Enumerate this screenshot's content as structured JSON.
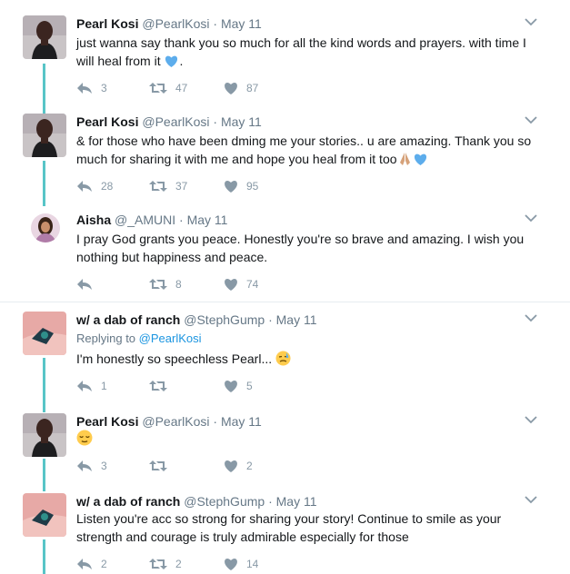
{
  "tweets": [
    {
      "name": "Pearl Kosi",
      "handle": "@PearlKosi",
      "date": "May 11",
      "text": "just wanna say thank you so much for all the kind words and prayers. with time I will heal from it",
      "emoji": "blue-heart",
      "text_suffix": ".",
      "replies": "3",
      "retweets": "47",
      "likes": "87"
    },
    {
      "name": "Pearl Kosi",
      "handle": "@PearlKosi",
      "date": "May 11",
      "text": "& for those who have been dming me your stories.. u are amazing. Thank you so much for sharing it with me and hope you heal from it too",
      "emoji": "praying-hands-and-blue-heart",
      "replies": "28",
      "retweets": "37",
      "likes": "95"
    },
    {
      "name": "Aisha",
      "handle": "@_AMUNI",
      "date": "May 11",
      "text": "I pray God grants you peace. Honestly you're so brave and amazing. I wish you nothing but happiness and peace.",
      "replies": "",
      "retweets": "8",
      "likes": "74"
    },
    {
      "name": "w/ a dab of ranch",
      "handle": "@StephGump",
      "date": "May 11",
      "replying_label": "Replying to",
      "replying_to": "@PearlKosi",
      "text": "I'm honestly so speechless Pearl...",
      "emoji": "sad-relieved-face",
      "replies": "1",
      "retweets": "",
      "likes": "5"
    },
    {
      "name": "Pearl Kosi",
      "handle": "@PearlKosi",
      "date": "May 11",
      "text": "",
      "emoji": "relieved-face",
      "replies": "3",
      "retweets": "",
      "likes": "2"
    },
    {
      "name": "w/ a dab of ranch",
      "handle": "@StephGump",
      "date": "May 11",
      "text": "Listen you're acc so strong for sharing your story! Continue to smile as your strength and courage is truly admirable especially for those",
      "replies": "2",
      "retweets": "2",
      "likes": "14"
    }
  ],
  "separator": "·",
  "colors": {
    "thread_line": "#58c5c7",
    "icon_gray": "#8899a6",
    "meta_gray": "#657786",
    "link_blue": "#1b95e0",
    "heart_blue": "#5dadec"
  }
}
